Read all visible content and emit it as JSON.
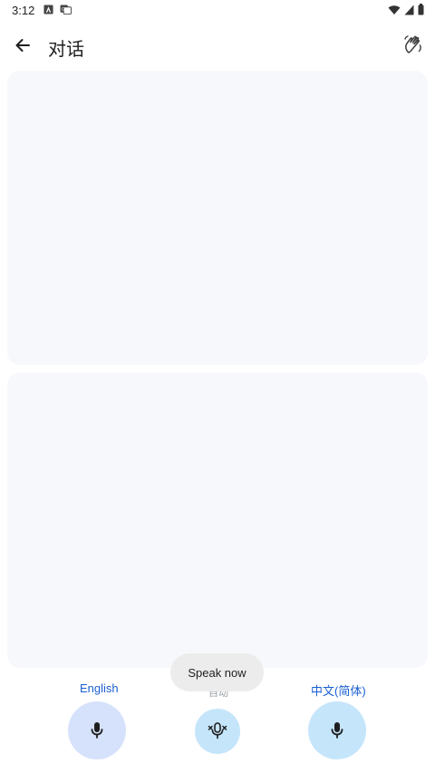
{
  "status_bar": {
    "time": "3:12",
    "left_icons": [
      "accessibility-icon",
      "translate-icon"
    ],
    "right_icons": [
      "wifi-icon",
      "signal-icon",
      "battery-icon"
    ]
  },
  "app_bar": {
    "title": "对话",
    "back_icon": "arrow-left-icon",
    "action_icon": "hand-wave-icon"
  },
  "languages": {
    "left": "English",
    "middle": "自动",
    "right": "中文(简体)"
  },
  "toast": {
    "text": "Speak now"
  },
  "colors": {
    "accent": "#1a5fd2",
    "panel_bg": "#f7f8fc",
    "mic_left_bg": "#d6e2fb",
    "mic_right_bg": "#c5e5fb",
    "toast_bg": "#ececec"
  }
}
